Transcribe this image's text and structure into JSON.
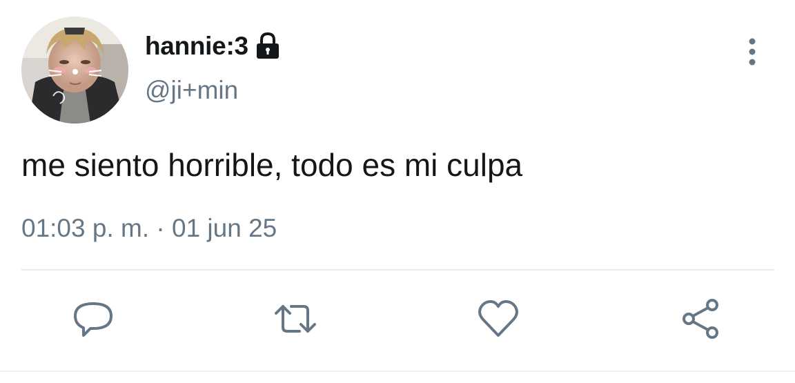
{
  "tweet": {
    "display_name": "hannie:3",
    "username": "@ji+min",
    "text": "me siento horrible, todo es mi culpa",
    "time": "01:03 p. m.",
    "separator": "·",
    "date": "01 jun 25",
    "protected": true
  },
  "icons": {
    "protected": "lock-icon",
    "more": "more-vertical-icon",
    "reply": "reply-icon",
    "retweet": "retweet-icon",
    "like": "heart-icon",
    "share": "share-icon"
  },
  "colors": {
    "text": "#14171a",
    "secondary": "#657786",
    "icon": "#657786",
    "divider": "#e6ecf0",
    "background": "#ffffff"
  }
}
